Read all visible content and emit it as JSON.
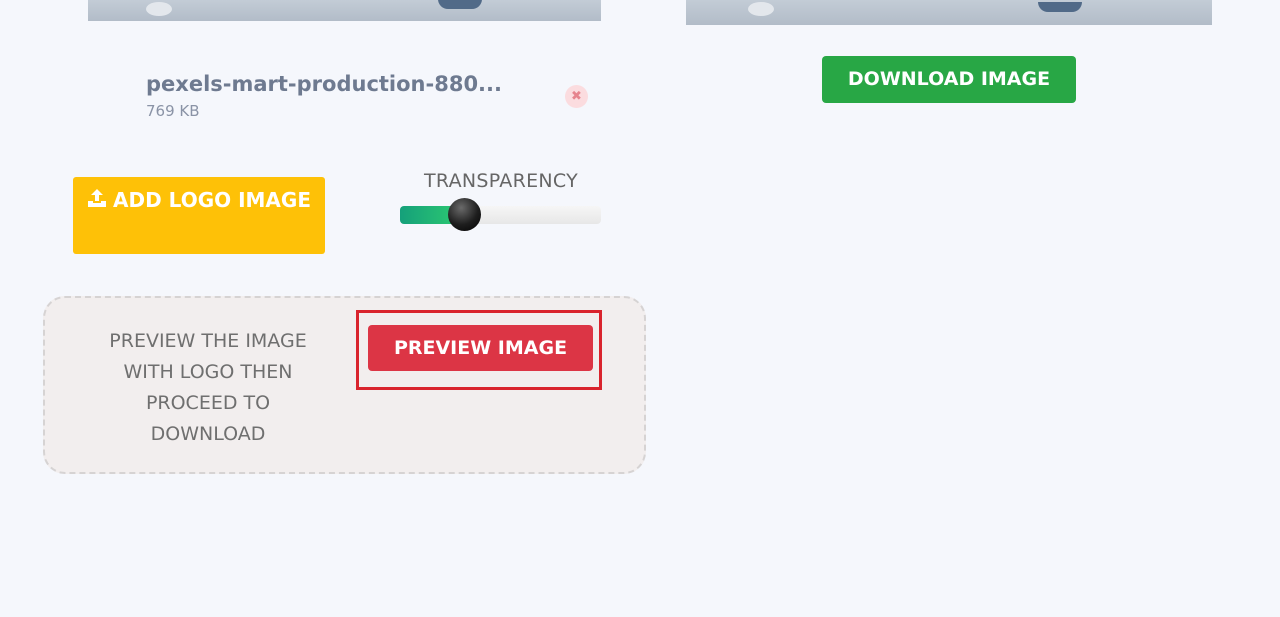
{
  "upload": {
    "file_name": "pexels-mart-production-880...",
    "file_size": "769 KB",
    "remove_glyph": "✖",
    "remove_icon": "close-icon"
  },
  "logo": {
    "add_button_label": "ADD LOGO IMAGE",
    "add_button_icon": "upload-icon"
  },
  "transparency": {
    "label": "TRANSPARENCY",
    "value_fraction": 0.32
  },
  "preview": {
    "instructions": "PREVIEW THE IMAGE WITH LOGO THEN PROCEED TO DOWNLOAD",
    "button_label": "PREVIEW IMAGE"
  },
  "download": {
    "button_label": "DOWNLOAD IMAGE"
  },
  "colors": {
    "background": "#f5f7fc",
    "add_logo_button": "#fec107",
    "preview_button": "#dc3545",
    "download_button": "#28a745",
    "highlight_frame": "#d9232d",
    "slider_fill": "#2ecc71"
  }
}
